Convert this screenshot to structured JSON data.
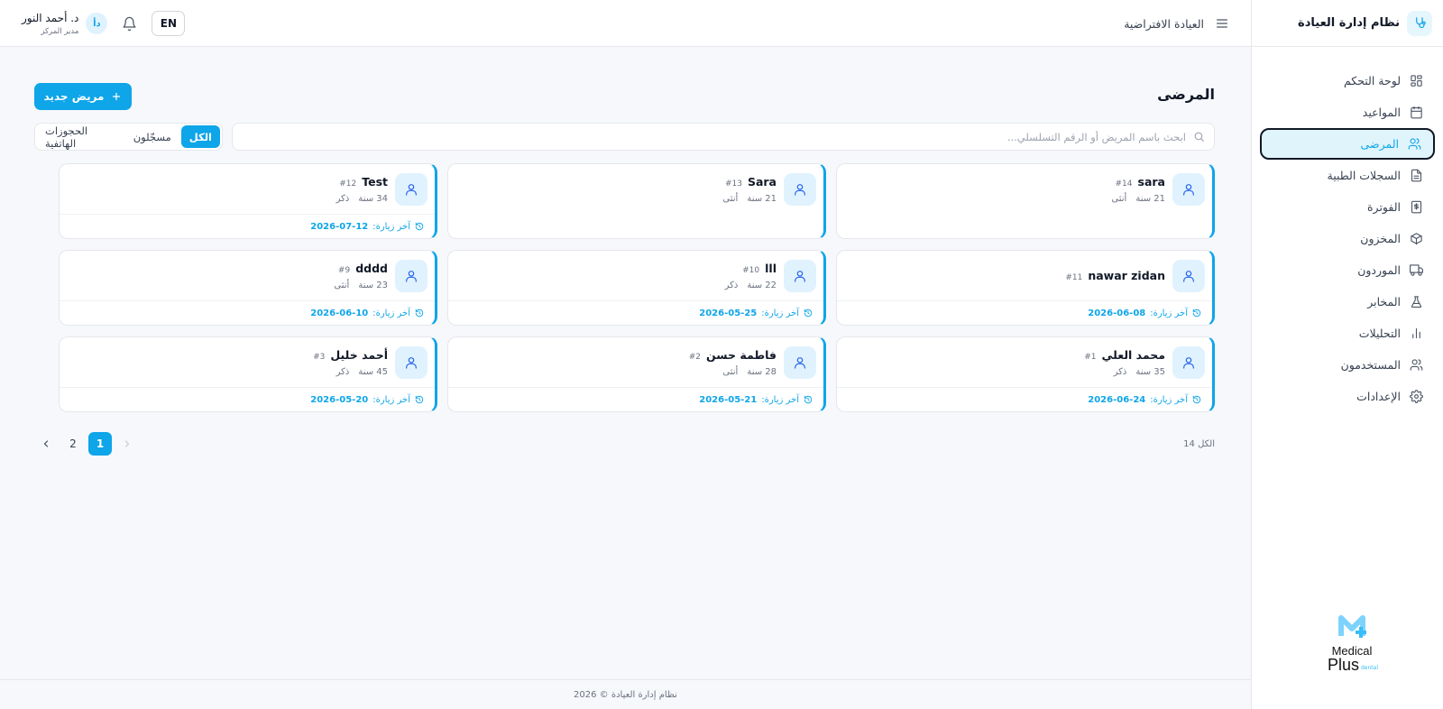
{
  "sidebar": {
    "brand_title": "نظام إدارة العيادة",
    "items": [
      {
        "label": "لوحة التحكم",
        "icon": "dashboard-icon",
        "active": false
      },
      {
        "label": "المواعيد",
        "icon": "calendar-icon",
        "active": false
      },
      {
        "label": "المرضى",
        "icon": "users-icon",
        "active": true
      },
      {
        "label": "السجلات الطبية",
        "icon": "file-text-icon",
        "active": false
      },
      {
        "label": "الفوترة",
        "icon": "invoice-icon",
        "active": false
      },
      {
        "label": "المخزون",
        "icon": "package-icon",
        "active": false
      },
      {
        "label": "الموردون",
        "icon": "truck-icon",
        "active": false
      },
      {
        "label": "المخابر",
        "icon": "flask-icon",
        "active": false
      },
      {
        "label": "التحليلات",
        "icon": "bar-chart-icon",
        "active": false
      },
      {
        "label": "المستخدمون",
        "icon": "user-group-icon",
        "active": false
      },
      {
        "label": "الإعدادات",
        "icon": "gear-icon",
        "active": false
      }
    ],
    "logo": {
      "line1": "Medical",
      "line2": "Plus",
      "line3": "dental"
    }
  },
  "header": {
    "clinic_name": "العيادة الافتراضية",
    "lang_button": "EN",
    "user_initials": "دأ",
    "user_name": "د. أحمد النور",
    "user_role": "مدير المركز"
  },
  "main": {
    "page_title": "المرضى",
    "new_patient_label": "مريض جديد",
    "search_placeholder": "ابحث باسم المريض أو الرقم التسلسلي...",
    "search_value": "",
    "filters": [
      "الكل",
      "مسجّلون",
      "الحجوزات الهاتفية"
    ],
    "active_filter": 0,
    "last_visit_label": "آخر زيارة:",
    "patients": [
      {
        "name": "sara",
        "id": "#14",
        "age": "21 سنة",
        "gender": "أنثى",
        "last_visit": "",
        "show_footer": false
      },
      {
        "name": "Sara",
        "id": "#13",
        "age": "21 سنة",
        "gender": "أنثى",
        "last_visit": "",
        "show_footer": false
      },
      {
        "name": "Test",
        "id": "#12",
        "age": "34 سنة",
        "gender": "ذكر",
        "last_visit": "2026-07-12",
        "show_footer": true
      },
      {
        "name": "nawar zidan",
        "id": "#11",
        "age": "",
        "gender": "",
        "last_visit": "2026-06-08",
        "show_footer": true
      },
      {
        "name": "lll",
        "id": "#10",
        "age": "22 سنة",
        "gender": "ذكر",
        "last_visit": "2026-05-25",
        "show_footer": true
      },
      {
        "name": "dddd",
        "id": "#9",
        "age": "23 سنة",
        "gender": "أنثى",
        "last_visit": "2026-06-10",
        "show_footer": true
      },
      {
        "name": "محمد العلي",
        "id": "#1",
        "age": "35 سنة",
        "gender": "ذكر",
        "last_visit": "2026-06-24",
        "show_footer": true
      },
      {
        "name": "فاطمة حسن",
        "id": "#2",
        "age": "28 سنة",
        "gender": "أنثى",
        "last_visit": "2026-05-21",
        "show_footer": true
      },
      {
        "name": "أحمد خليل",
        "id": "#3",
        "age": "45 سنة",
        "gender": "ذكر",
        "last_visit": "2026-05-20",
        "show_footer": true
      }
    ],
    "total_label": "14 الكل",
    "pagination": {
      "pages": [
        "1",
        "2"
      ],
      "current": "1"
    }
  },
  "footer": {
    "text": "نظام إدارة العيادة © 2026"
  },
  "colors": {
    "accent": "#0ea5e9",
    "accent_light": "#e0f2fe",
    "active_nav_bg": "#e0f4fc"
  }
}
